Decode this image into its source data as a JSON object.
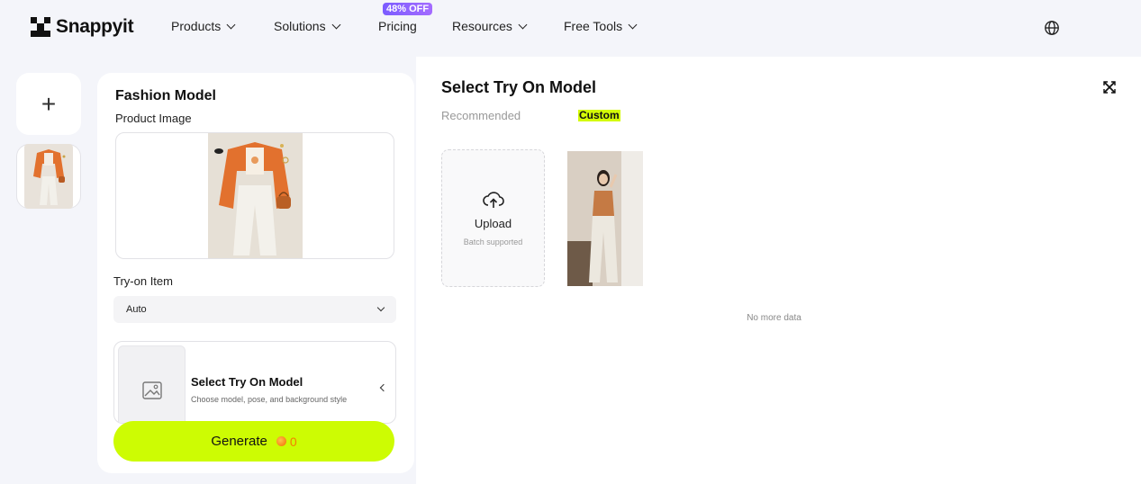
{
  "brand": {
    "name": "Snappyit"
  },
  "nav": {
    "items": [
      {
        "label": "Products"
      },
      {
        "label": "Solutions"
      },
      {
        "label": "Pricing"
      },
      {
        "label": "Resources"
      },
      {
        "label": "Free Tools"
      }
    ],
    "promo_badge": "48% OFF"
  },
  "panel": {
    "title": "Fashion Model",
    "product_image_label": "Product Image",
    "tryon_item_label": "Try-on Item",
    "tryon_item_value": "Auto",
    "model_card": {
      "title": "Select Try On Model",
      "description": "Choose model, pose, and background style"
    },
    "generate": {
      "label": "Generate",
      "cost": "0"
    }
  },
  "right": {
    "title": "Select Try On Model",
    "tabs": [
      {
        "label": "Recommended"
      },
      {
        "label": "Custom"
      }
    ],
    "upload": {
      "label": "Upload",
      "hint": "Batch supported"
    },
    "empty_text": "No more data"
  },
  "colors": {
    "accent": "#cdfc03",
    "coin": "#f47f00",
    "promo": "#8a5cff"
  }
}
